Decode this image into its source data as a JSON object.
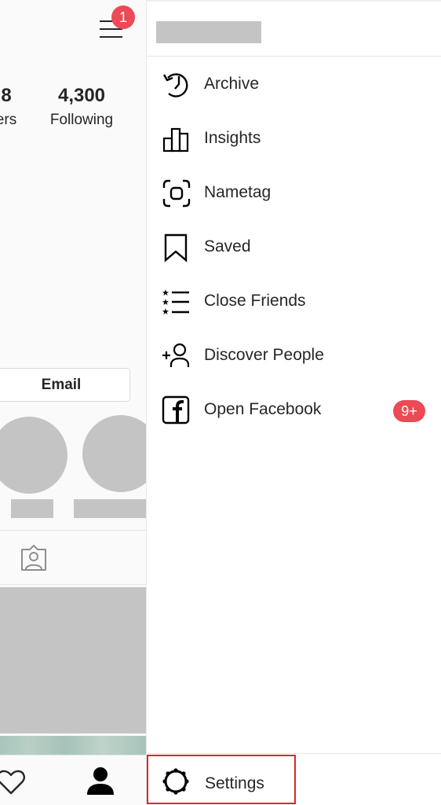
{
  "profile": {
    "notification_count": "1",
    "stats": [
      {
        "value": "8",
        "label": "ers"
      },
      {
        "value": "4,300",
        "label": "Following"
      }
    ],
    "email_button_label": "Email"
  },
  "drawer": {
    "menu_items": [
      {
        "label": "Archive",
        "icon": "archive-clock-icon"
      },
      {
        "label": "Insights",
        "icon": "bar-chart-icon"
      },
      {
        "label": "Nametag",
        "icon": "nametag-icon"
      },
      {
        "label": "Saved",
        "icon": "bookmark-icon"
      },
      {
        "label": "Close Friends",
        "icon": "star-list-icon"
      },
      {
        "label": "Discover People",
        "icon": "add-person-icon"
      },
      {
        "label": "Open Facebook",
        "icon": "facebook-icon",
        "badge": "9+"
      }
    ],
    "settings_label": "Settings"
  },
  "colors": {
    "badge": "#ed4956",
    "highlight_border": "#e0242f",
    "text": "#262626",
    "placeholder": "#c4c4c4"
  }
}
